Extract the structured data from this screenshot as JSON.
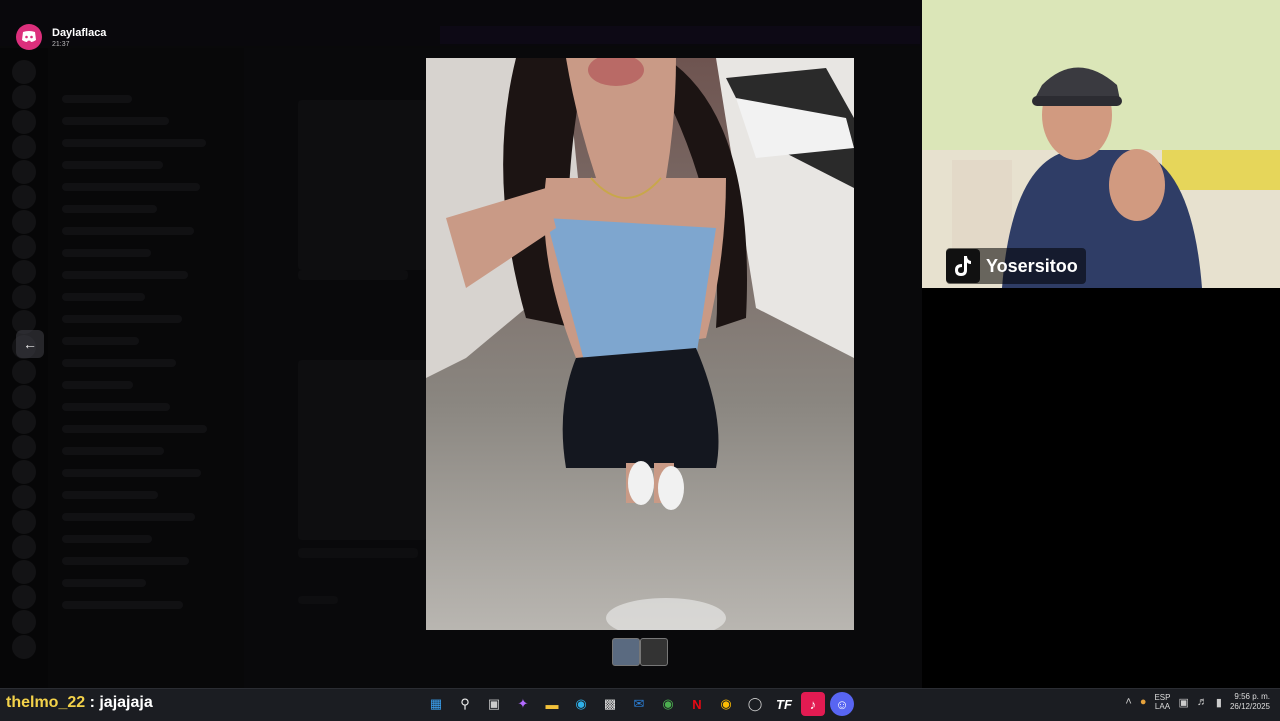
{
  "notification": {
    "username": "Daylaflaca",
    "time": "21:37",
    "app_icon": "discord-icon"
  },
  "viewer": {
    "prev_icon": "arrow-left-icon",
    "next_icon": "arrow-right-icon",
    "thumbnail_count": 2
  },
  "webcam": {
    "platform_icon": "tiktok-icon",
    "handle": "Yosersitoo"
  },
  "chat_overlay": {
    "username": "thelmo_22",
    "separator": " : ",
    "message": "jajajaja",
    "username_color": "#f3d24a"
  },
  "taskbar": {
    "apps": [
      "windows-start-icon",
      "search-icon",
      "task-view-icon",
      "copilot-icon",
      "file-explorer-icon",
      "edge-icon",
      "store-icon",
      "outlook-icon",
      "chrome-icon",
      "netflix-icon",
      "chrome-icon",
      "obs-icon",
      "tf-icon",
      "tiktok-icon",
      "discord-icon"
    ],
    "language": "ESP",
    "language_sub": "LAA",
    "time": "9:56 p. m.",
    "date": "26/12/2025"
  },
  "colors": {
    "discord_accent": "#dc2f7c",
    "taskbar_bg": "#1b1d22"
  }
}
